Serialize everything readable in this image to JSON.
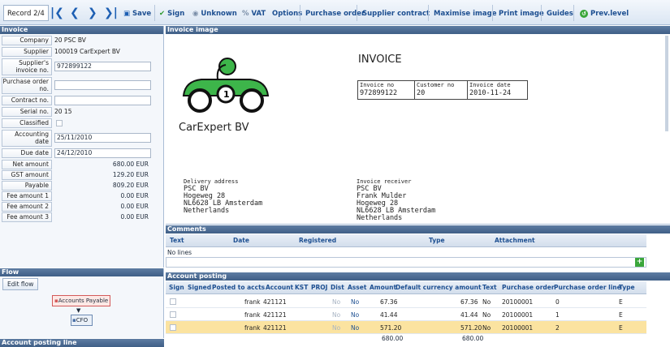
{
  "toolbar": {
    "record": "Record 2/4",
    "save": "Save",
    "sign": "Sign",
    "unknown": "Unknown",
    "vat": "VAT",
    "options": "Options",
    "purchase_order": "Purchase order",
    "supplier_contract": "Supplier contract",
    "maximise_image": "Maximise image",
    "print_image": "Print image",
    "guides": "Guides",
    "prev_level": "Prev.level"
  },
  "invoice_panel": {
    "title": "Invoice",
    "company_label": "Company",
    "company": "20 PSC BV",
    "supplier_label": "Supplier",
    "supplier": "100019 CarExpert BV",
    "supplier_invoice_label": "Supplier's invoice no.",
    "supplier_invoice": "972899122",
    "po_label": "Purchase order no.",
    "po": "",
    "contract_label": "Contract no.",
    "contract": "",
    "serial_label": "Serial no.",
    "serial": "20 15",
    "classified_label": "Classified",
    "acc_date_label": "Accounting date",
    "acc_date": "25/11/2010",
    "due_label": "Due date",
    "due": "24/12/2010",
    "net_label": "Net amount",
    "net": "680.00 EUR",
    "gst_label": "GST amount",
    "gst": "129.20 EUR",
    "payable_label": "Payable",
    "payable": "809.20 EUR",
    "fee1_label": "Fee amount 1",
    "fee1": "0.00 EUR",
    "fee2_label": "Fee amount 2",
    "fee2": "0.00 EUR",
    "fee3_label": "Fee amount 3",
    "fee3": "0.00 EUR"
  },
  "flow": {
    "title": "Flow",
    "edit": "Edit flow",
    "node1": "Accounts Payable",
    "node2": "CFO"
  },
  "account_posting_line": {
    "title": "Account posting line"
  },
  "invoice_image": {
    "title": "Invoice image",
    "heading": "INVOICE",
    "company": "CarExpert BV",
    "inv_no_label": "Invoice no",
    "inv_no": "972899122",
    "cust_no_label": "Customer no",
    "cust_no": "20",
    "inv_date_label": "Invoice date",
    "inv_date": "2010-11-24",
    "delivery": [
      "Delivery address",
      "PSC BV",
      "Hogeweg 28",
      "NL6628 LB  Amsterdam",
      "Netherlands"
    ],
    "receiver": [
      "Invoice receiver",
      "PSC BV",
      "Frank Mulder",
      "Hogeweg 28",
      "NL6628 LB  Amsterdam",
      "Netherlands"
    ]
  },
  "comments": {
    "title": "Comments",
    "cols": [
      "Text",
      "Date",
      "Registered",
      "Type",
      "Attachment"
    ],
    "empty": "No lines"
  },
  "posting": {
    "title": "Account posting",
    "cols": [
      "Sign",
      "Signed",
      "Posted to accts",
      "Account",
      "KST",
      "PROJ",
      "Dist",
      "Asset",
      "Amount",
      "Default currency amount",
      "Text",
      "Purchase order",
      "Purchase order line",
      "Type"
    ],
    "rows": [
      {
        "posted": "frank",
        "account": "421121",
        "dist": "No",
        "asset": "No",
        "amount": "67.36",
        "default": "67.36",
        "text": "No",
        "po": "20100001",
        "po_line": "0",
        "type": "E"
      },
      {
        "posted": "frank",
        "account": "421121",
        "dist": "No",
        "asset": "No",
        "amount": "41.44",
        "default": "41.44",
        "text": "No",
        "po": "20100001",
        "po_line": "1",
        "type": "E"
      },
      {
        "posted": "frank",
        "account": "421121",
        "dist": "No",
        "asset": "No",
        "amount": "571.20",
        "default": "571.20",
        "text": "No",
        "po": "20100001",
        "po_line": "2",
        "type": "E"
      }
    ],
    "total_amount": "680.00",
    "total_default": "680.00"
  },
  "colors": {
    "header": "#4a6890",
    "accent": "#1d4f91",
    "selected_row": "#fbe3a0"
  }
}
